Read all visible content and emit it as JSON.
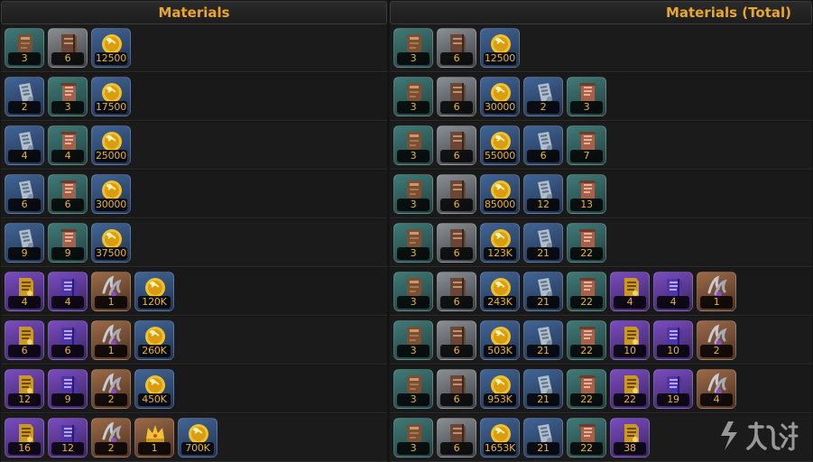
{
  "headers": {
    "left": "Materials",
    "right": "Materials (Total)"
  },
  "rows": [
    {
      "left": [
        [
          "brown-scroll",
          "teal",
          "3"
        ],
        [
          "brown-book",
          "steel",
          "6"
        ],
        [
          "gold-coin",
          "blue",
          "12500"
        ]
      ],
      "right": [
        [
          "brown-scroll",
          "teal",
          "3"
        ],
        [
          "brown-book",
          "steel",
          "6"
        ],
        [
          "gold-coin",
          "blue",
          "12500"
        ]
      ]
    },
    {
      "left": [
        [
          "silver-scroll",
          "blue",
          "2"
        ],
        [
          "red-scroll",
          "teal",
          "3"
        ],
        [
          "gold-coin",
          "blue",
          "17500"
        ]
      ],
      "right": [
        [
          "brown-scroll",
          "teal",
          "3"
        ],
        [
          "brown-book",
          "steel",
          "6"
        ],
        [
          "gold-coin",
          "blue",
          "30000"
        ],
        [
          "silver-scroll",
          "blue",
          "2"
        ],
        [
          "red-scroll",
          "teal",
          "3"
        ]
      ]
    },
    {
      "left": [
        [
          "silver-scroll",
          "blue",
          "4"
        ],
        [
          "red-scroll",
          "teal",
          "4"
        ],
        [
          "gold-coin",
          "blue",
          "25000"
        ]
      ],
      "right": [
        [
          "brown-scroll",
          "teal",
          "3"
        ],
        [
          "brown-book",
          "steel",
          "6"
        ],
        [
          "gold-coin",
          "blue",
          "55000"
        ],
        [
          "silver-scroll",
          "blue",
          "6"
        ],
        [
          "red-scroll",
          "teal",
          "7"
        ]
      ]
    },
    {
      "left": [
        [
          "silver-scroll",
          "blue",
          "6"
        ],
        [
          "red-scroll",
          "teal",
          "6"
        ],
        [
          "gold-coin",
          "blue",
          "30000"
        ]
      ],
      "right": [
        [
          "brown-scroll",
          "teal",
          "3"
        ],
        [
          "brown-book",
          "steel",
          "6"
        ],
        [
          "gold-coin",
          "blue",
          "85000"
        ],
        [
          "silver-scroll",
          "blue",
          "12"
        ],
        [
          "red-scroll",
          "teal",
          "13"
        ]
      ]
    },
    {
      "left": [
        [
          "silver-scroll",
          "blue",
          "9"
        ],
        [
          "red-scroll",
          "teal",
          "9"
        ],
        [
          "gold-coin",
          "blue",
          "37500"
        ]
      ],
      "right": [
        [
          "brown-scroll",
          "teal",
          "3"
        ],
        [
          "brown-book",
          "steel",
          "6"
        ],
        [
          "gold-coin",
          "blue",
          "123K"
        ],
        [
          "silver-scroll",
          "blue",
          "21"
        ],
        [
          "red-scroll",
          "teal",
          "22"
        ]
      ]
    },
    {
      "left": [
        [
          "gold-scroll",
          "purple",
          "4"
        ],
        [
          "purple-book",
          "purple",
          "4"
        ],
        [
          "claw-relic",
          "orange",
          "1"
        ],
        [
          "gold-coin",
          "blue",
          "120K"
        ]
      ],
      "right": [
        [
          "brown-scroll",
          "teal",
          "3"
        ],
        [
          "brown-book",
          "steel",
          "6"
        ],
        [
          "gold-coin",
          "blue",
          "243K"
        ],
        [
          "silver-scroll",
          "blue",
          "21"
        ],
        [
          "red-scroll",
          "teal",
          "22"
        ],
        [
          "gold-scroll",
          "purple",
          "4"
        ],
        [
          "purple-book",
          "purple",
          "4"
        ],
        [
          "claw-relic",
          "orange",
          "1"
        ]
      ]
    },
    {
      "left": [
        [
          "gold-scroll",
          "purple",
          "6"
        ],
        [
          "purple-book",
          "purple",
          "6"
        ],
        [
          "claw-relic",
          "orange",
          "1"
        ],
        [
          "gold-coin",
          "blue",
          "260K"
        ]
      ],
      "right": [
        [
          "brown-scroll",
          "teal",
          "3"
        ],
        [
          "brown-book",
          "steel",
          "6"
        ],
        [
          "gold-coin",
          "blue",
          "503K"
        ],
        [
          "silver-scroll",
          "blue",
          "21"
        ],
        [
          "red-scroll",
          "teal",
          "22"
        ],
        [
          "gold-scroll",
          "purple",
          "10"
        ],
        [
          "purple-book",
          "purple",
          "10"
        ],
        [
          "claw-relic",
          "orange",
          "2"
        ]
      ]
    },
    {
      "left": [
        [
          "gold-scroll",
          "purple",
          "12"
        ],
        [
          "purple-book",
          "purple",
          "9"
        ],
        [
          "claw-relic",
          "orange",
          "2"
        ],
        [
          "gold-coin",
          "blue",
          "450K"
        ]
      ],
      "right": [
        [
          "brown-scroll",
          "teal",
          "3"
        ],
        [
          "brown-book",
          "steel",
          "6"
        ],
        [
          "gold-coin",
          "blue",
          "953K"
        ],
        [
          "silver-scroll",
          "blue",
          "21"
        ],
        [
          "red-scroll",
          "teal",
          "22"
        ],
        [
          "gold-scroll",
          "purple",
          "22"
        ],
        [
          "purple-book",
          "purple",
          "19"
        ],
        [
          "claw-relic",
          "orange",
          "4"
        ]
      ]
    },
    {
      "left": [
        [
          "gold-scroll",
          "purple",
          "16"
        ],
        [
          "purple-book",
          "purple",
          "12"
        ],
        [
          "claw-relic",
          "orange",
          "2"
        ],
        [
          "gold-crown",
          "orange",
          "1"
        ],
        [
          "gold-coin",
          "blue",
          "700K"
        ]
      ],
      "right": [
        [
          "brown-scroll",
          "teal",
          "3"
        ],
        [
          "brown-book",
          "steel",
          "6"
        ],
        [
          "gold-coin",
          "blue",
          "1653K"
        ],
        [
          "silver-scroll",
          "blue",
          "21"
        ],
        [
          "red-scroll",
          "teal",
          "22"
        ],
        [
          "gold-scroll",
          "purple",
          "38"
        ]
      ]
    }
  ]
}
